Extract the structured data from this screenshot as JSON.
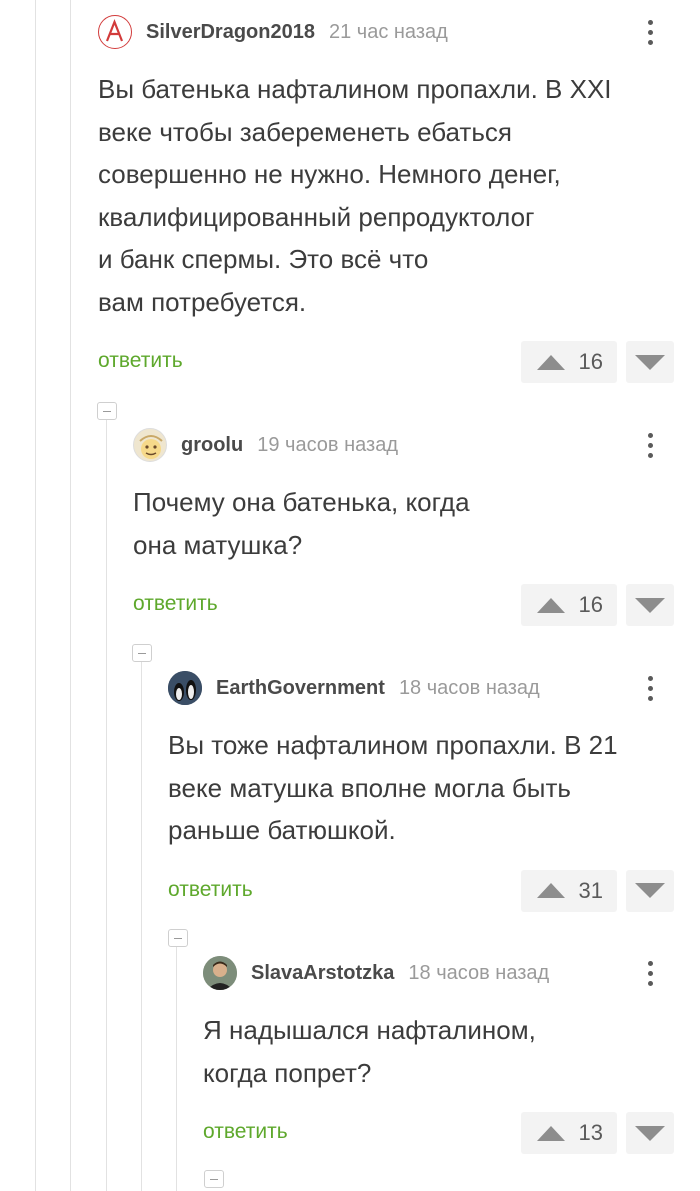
{
  "comments": [
    {
      "author": "SilverDragon2018",
      "time": "21 час назад",
      "avatar_icon": "anarchy-a-icon",
      "text": "Вы батенька нафталином пропахли. В XXI\nвеке чтобы забеременеть ебаться\nсовершенно не нужно. Немного денег,\nквалифицированный репродуктолог\nи банк спермы. Это всё что\nвам потребуется.",
      "reply_label": "ответить",
      "rating": "16"
    },
    {
      "author": "groolu",
      "time": "19 часов назад",
      "avatar_icon": "cartoon-face-avatar",
      "text": "Почему она батенька, когда\nона матушка?",
      "reply_label": "ответить",
      "rating": "16"
    },
    {
      "author": "EarthGovernment",
      "time": "18 часов назад",
      "avatar_icon": "penguins-avatar",
      "text": "Вы тоже нафталином пропахли. В 21\nвеке матушка вполне могла быть\nраньше батюшкой.",
      "reply_label": "ответить",
      "rating": "31"
    },
    {
      "author": "SlavaArstotzka",
      "time": "18 часов назад",
      "avatar_icon": "person-photo-avatar",
      "text": "Я надышался нафталином,\nкогда попрет?",
      "reply_label": "ответить",
      "rating": "13"
    }
  ],
  "colors": {
    "reply_link": "#5ea82c",
    "vote_background": "#f3f3f3",
    "thread_line": "#e2e2e2"
  }
}
